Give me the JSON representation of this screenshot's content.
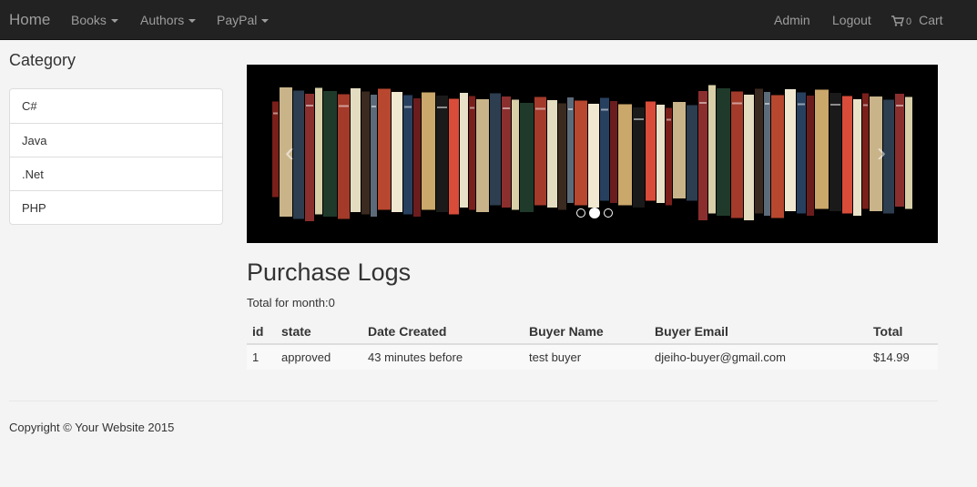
{
  "nav": {
    "brand": "Home",
    "books": "Books",
    "authors": "Authors",
    "paypal": "PayPal",
    "admin": "Admin",
    "logout": "Logout",
    "cart_count": "0",
    "cart": "Cart"
  },
  "sidebar": {
    "title": "Category",
    "items": [
      {
        "label": "C#"
      },
      {
        "label": "Java"
      },
      {
        "label": ".Net"
      },
      {
        "label": "PHP"
      }
    ]
  },
  "carousel": {
    "prev": "‹",
    "next": "›",
    "slide_count": 3,
    "active_slide": 2
  },
  "main": {
    "title": "Purchase Logs",
    "total_month": "Total for month:0",
    "table": {
      "headers": [
        "id",
        "state",
        "Date Created",
        "Buyer Name",
        "Buyer Email",
        "Total"
      ],
      "rows": [
        [
          "1",
          "approved",
          "43 minutes before",
          "test buyer",
          "djeiho-buyer@gmail.com",
          "$14.99"
        ]
      ]
    }
  },
  "footer": {
    "copyright": "Copyright © Your Website 2015"
  }
}
